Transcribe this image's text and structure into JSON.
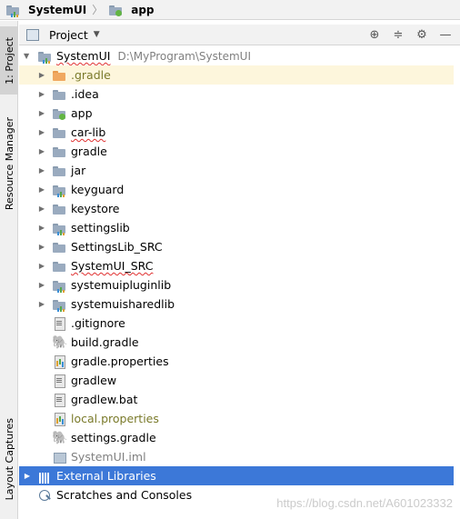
{
  "breadcrumb": [
    {
      "label": "SystemUI",
      "icon": "module-folder-icon"
    },
    {
      "label": "app",
      "icon": "folder-icon"
    }
  ],
  "stripe": {
    "tabs": [
      {
        "label": "1: Project",
        "active": true
      },
      {
        "label": "Resource Manager",
        "active": false
      },
      {
        "label": "Layout Captures",
        "active": false
      }
    ]
  },
  "panel": {
    "title": "Project",
    "dropdown_icon": "chevron-down-icon",
    "tools": [
      "locate-icon",
      "collapse-all-icon",
      "gear-icon",
      "minimize-icon"
    ]
  },
  "tree": {
    "root": {
      "label": "SystemUI",
      "path": "D:\\MyProgram\\SystemUI"
    },
    "items": [
      {
        "label": ".gradle",
        "icon": "folder-orange",
        "expandable": true,
        "style": "olive",
        "highlight": true
      },
      {
        "label": ".idea",
        "icon": "folder",
        "expandable": true
      },
      {
        "label": "app",
        "icon": "folder-green",
        "expandable": true
      },
      {
        "label": "car-lib",
        "icon": "folder",
        "expandable": true,
        "squiggle": true
      },
      {
        "label": "gradle",
        "icon": "folder",
        "expandable": true
      },
      {
        "label": "jar",
        "icon": "folder",
        "expandable": true
      },
      {
        "label": "keyguard",
        "icon": "folder-module",
        "expandable": true
      },
      {
        "label": "keystore",
        "icon": "folder",
        "expandable": true
      },
      {
        "label": "settingslib",
        "icon": "folder-module",
        "expandable": true
      },
      {
        "label": "SettingsLib_SRC",
        "icon": "folder",
        "expandable": true
      },
      {
        "label": "SystemUI_SRC",
        "icon": "folder",
        "expandable": true,
        "squiggle": true
      },
      {
        "label": "systemuipluginlib",
        "icon": "folder-module",
        "expandable": true
      },
      {
        "label": "systemuisharedlib",
        "icon": "folder-module",
        "expandable": true
      },
      {
        "label": ".gitignore",
        "icon": "file",
        "expandable": false
      },
      {
        "label": "build.gradle",
        "icon": "gradle",
        "expandable": false
      },
      {
        "label": "gradle.properties",
        "icon": "properties",
        "expandable": false
      },
      {
        "label": "gradlew",
        "icon": "file",
        "expandable": false
      },
      {
        "label": "gradlew.bat",
        "icon": "file",
        "expandable": false
      },
      {
        "label": "local.properties",
        "icon": "properties",
        "expandable": false,
        "style": "olive"
      },
      {
        "label": "settings.gradle",
        "icon": "gradle",
        "expandable": false
      },
      {
        "label": "SystemUI.iml",
        "icon": "iml",
        "expandable": false,
        "style": "gray"
      }
    ],
    "external_libraries": "External Libraries",
    "scratches": "Scratches and Consoles"
  },
  "watermark": "https://blog.csdn.net/A601023332",
  "colors": {
    "selection": "#3c78d8",
    "highlight": "#fdf6dc",
    "olive_text": "#7a7a2a"
  }
}
